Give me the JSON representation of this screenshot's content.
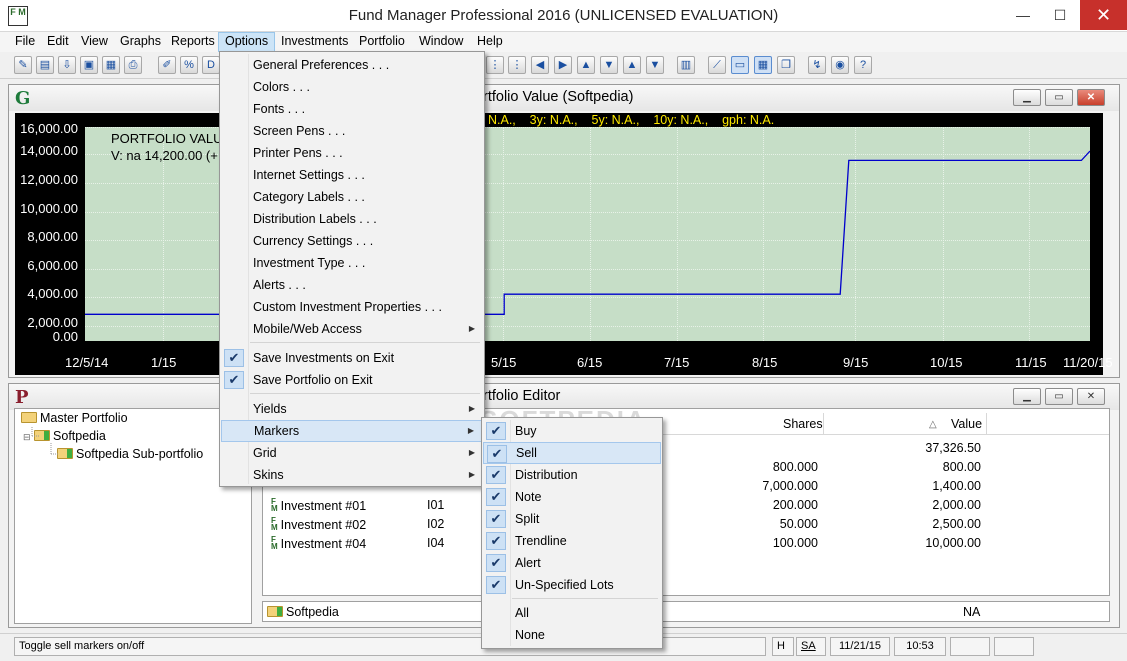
{
  "window": {
    "title": "Fund Manager Professional 2016 (UNLICENSED EVALUATION)",
    "icon_text": "F M",
    "minimize": "—",
    "maximize": "☐",
    "close": "✕"
  },
  "menubar": [
    "File",
    "Edit",
    "View",
    "Graphs",
    "Reports",
    "Options",
    "Investments",
    "Portfolio",
    "Window",
    "Help"
  ],
  "graph_window": {
    "letter": "G",
    "title": "Portfolio Value (Softpedia)",
    "title_visible": "rtfolio Value (Softpedia)",
    "stats": "N.A.,    3y: N.A.,    5y: N.A.,    10y: N.A.,    gph: N.A.",
    "legend_line1": "PORTFOLIO VALUE",
    "legend_line2": "V: na 14,200.00 (+ 8",
    "line_color": "#0000cc",
    "plot_bg": "#c6dec7"
  },
  "chart_data": {
    "type": "line",
    "x_tick_labels": [
      "12/5/14",
      "1/15",
      "5/15",
      "6/15",
      "7/15",
      "8/15",
      "9/15",
      "10/15",
      "11/15",
      "11/20/15"
    ],
    "y_tick_labels": [
      "16,000.00",
      "14,000.00",
      "12,000.00",
      "10,000.00",
      "8,000.00",
      "6,000.00",
      "4,000.00",
      "2,000.00",
      "0.00"
    ],
    "ylim": [
      0,
      16000
    ],
    "series": [
      {
        "name": "PORTFOLIO VALUE",
        "x": [
          "12/5/14",
          "4/30/15",
          "4/30/15",
          "8/25/15",
          "8/28/15",
          "11/17/15",
          "11/20/15"
        ],
        "y": [
          2000,
          2000,
          3500,
          3500,
          13500,
          13500,
          14200
        ]
      }
    ],
    "grid": true
  },
  "portfolio_window": {
    "letter": "P",
    "title": "Portfolio Editor",
    "title_visible": "rtfolio Editor",
    "tree": [
      {
        "label": "Master Portfolio",
        "level": 0
      },
      {
        "label": "Softpedia",
        "level": 1
      },
      {
        "label": "Softpedia Sub-portfolio",
        "level": 2
      }
    ],
    "columns": {
      "shares": "Shares",
      "value": "Value",
      "sort_glyph": "△"
    },
    "rows": [
      {
        "name": "",
        "code": "",
        "shares": "",
        "value": "37,326.50"
      },
      {
        "name": "",
        "code": "",
        "shares": "800.000",
        "value": "800.00"
      },
      {
        "name": "",
        "code": "",
        "shares": "7,000.000",
        "value": "1,400.00"
      },
      {
        "name": "Investment #01",
        "code": "I01",
        "shares": "200.000",
        "value": "2,000.00"
      },
      {
        "name": "Investment #02",
        "code": "I02",
        "shares": "50.000",
        "value": "2,500.00"
      },
      {
        "name": "Investment #04",
        "code": "I04",
        "shares": "100.000",
        "value": "10,000.00"
      }
    ],
    "footer": {
      "name": "Softpedia",
      "value": "NA"
    }
  },
  "options_menu": [
    {
      "label": "General Preferences . . .",
      "type": "item"
    },
    {
      "label": "Colors . . .",
      "type": "item"
    },
    {
      "label": "Fonts . . .",
      "type": "item"
    },
    {
      "label": "Screen Pens . . .",
      "type": "item"
    },
    {
      "label": "Printer Pens . . .",
      "type": "item"
    },
    {
      "label": "Internet Settings . . .",
      "type": "item"
    },
    {
      "label": "Category Labels . . .",
      "type": "item"
    },
    {
      "label": "Distribution Labels . . .",
      "type": "item"
    },
    {
      "label": "Currency Settings . . .",
      "type": "item"
    },
    {
      "label": "Investment Type . . .",
      "type": "item"
    },
    {
      "label": "Alerts . . .",
      "type": "item"
    },
    {
      "label": "Custom Investment Properties . . .",
      "type": "item"
    },
    {
      "label": "Mobile/Web Access",
      "type": "submenu"
    },
    {
      "label": "Save Investments on Exit",
      "type": "check"
    },
    {
      "label": "Save Portfolio on Exit",
      "type": "check"
    },
    {
      "label": "Yields",
      "type": "submenu"
    },
    {
      "label": "Markers",
      "type": "submenu"
    },
    {
      "label": "Grid",
      "type": "submenu"
    },
    {
      "label": "Skins",
      "type": "submenu"
    }
  ],
  "markers_menu": [
    {
      "label": "Buy",
      "checked": true
    },
    {
      "label": "Sell",
      "checked": true
    },
    {
      "label": "Distribution",
      "checked": true
    },
    {
      "label": "Note",
      "checked": true
    },
    {
      "label": "Split",
      "checked": true
    },
    {
      "label": "Trendline",
      "checked": true
    },
    {
      "label": "Alert",
      "checked": true
    },
    {
      "label": "Un-Specified Lots",
      "checked": true
    },
    {
      "label": "All",
      "checked": false
    },
    {
      "label": "None",
      "checked": false
    }
  ],
  "watermark": "SOFTPEDIA",
  "statusbar": {
    "message": "Toggle sell markers on/off",
    "h": "H",
    "sa": "SA",
    "date": "11/21/15",
    "time": "10:53"
  }
}
